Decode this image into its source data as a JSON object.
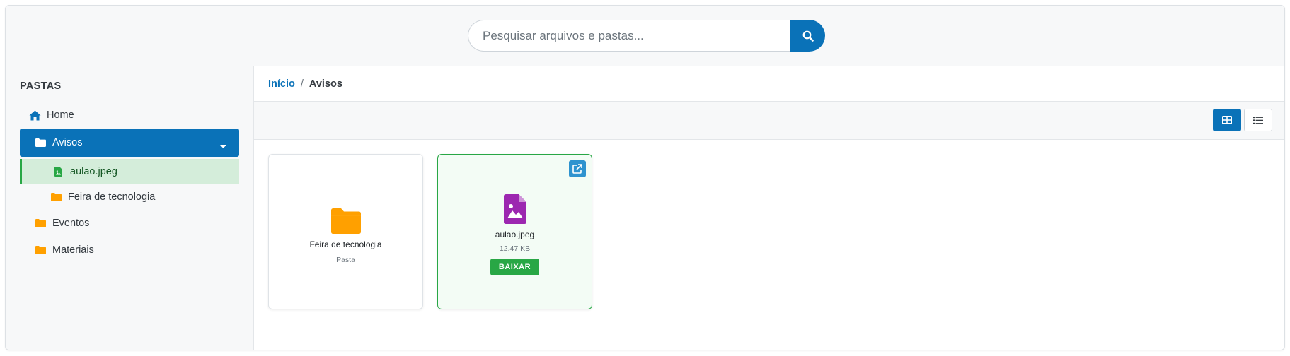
{
  "search": {
    "placeholder": "Pesquisar arquivos e pastas...",
    "icon": "search-icon"
  },
  "sidebar": {
    "title": "PASTAS",
    "items": [
      {
        "label": "Home",
        "icon": "home-icon"
      },
      {
        "label": "Avisos",
        "icon": "folder-icon",
        "active": true,
        "expanded": true
      },
      {
        "label": "aulao.jpeg",
        "icon": "image-file-icon",
        "selected": true
      },
      {
        "label": "Feira de tecnologia",
        "icon": "folder-icon"
      },
      {
        "label": "Eventos",
        "icon": "folder-icon"
      },
      {
        "label": "Materiais",
        "icon": "folder-icon"
      }
    ]
  },
  "breadcrumb": {
    "home": "Início",
    "separator": "/",
    "current": "Avisos"
  },
  "view": {
    "mode": "grid",
    "options": [
      "grid",
      "list"
    ]
  },
  "cards": [
    {
      "name": "Feira de tecnologia",
      "sub": "Pasta",
      "type": "folder"
    },
    {
      "name": "aulao.jpeg",
      "size": "12.47 KB",
      "action": "BAIXAR",
      "type": "image"
    }
  ],
  "colors": {
    "primary": "#0a72b8",
    "success": "#28a745",
    "folder": "#ffa000",
    "image": "#9c27b0",
    "selected_bg": "#d4edda"
  }
}
